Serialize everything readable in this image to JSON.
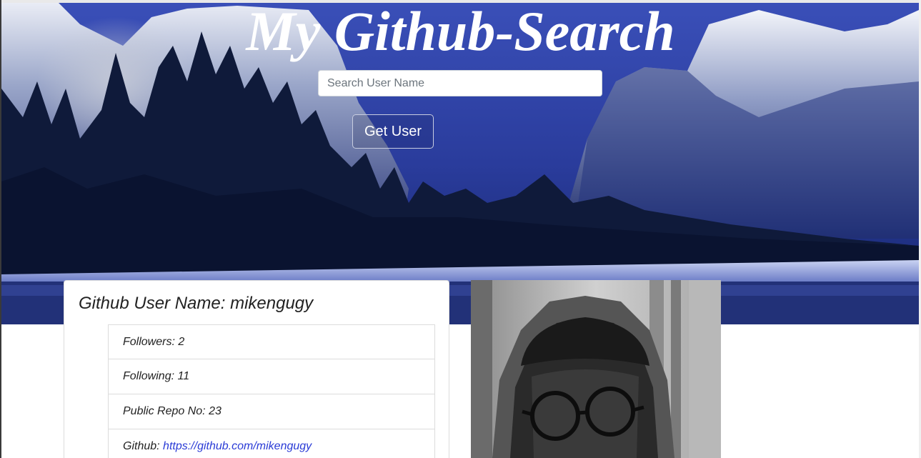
{
  "header": {
    "title": "My Github-Search"
  },
  "search": {
    "placeholder": "Search User Name",
    "value": "",
    "button_label": "Get User"
  },
  "profile": {
    "title_prefix": "Github User Name:",
    "username": "mikengugy",
    "stats": [
      {
        "label": "Followers:",
        "value": "2"
      },
      {
        "label": "Following:",
        "value": "11"
      },
      {
        "label": "Public Repo No:",
        "value": "23"
      }
    ],
    "github_label": "Github:",
    "github_url": "https://github.com/mikengugy"
  },
  "icons": {
    "avatar": "user-avatar-photo",
    "hero": "mountain-landscape-image"
  }
}
